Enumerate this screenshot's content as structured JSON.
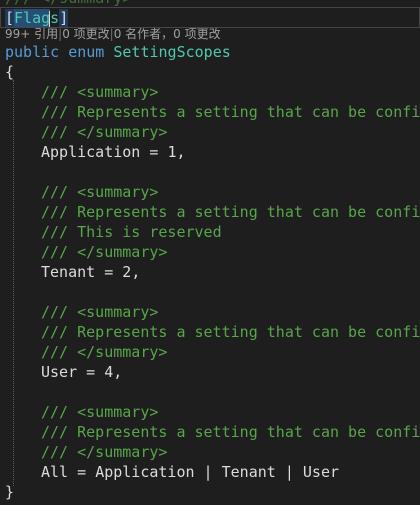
{
  "editor": {
    "previous_line_fragment": "/// </summary>",
    "attribute": {
      "open_bracket": "[",
      "name_selected": "Flag",
      "name_rest": "s",
      "close_bracket": "]"
    },
    "codelens": {
      "references": "99+ 引用",
      "sep1": "|",
      "changes": "0 项更改",
      "sep2": "|",
      "authors": "0 名作者，0 项更改"
    },
    "declaration": {
      "keyword_public": "public",
      "keyword_enum": "enum",
      "type_name": "SettingScopes"
    },
    "open_brace": "{",
    "close_brace": "}",
    "members": [
      {
        "doc_lines": [
          "/// <summary>",
          "/// Represents a setting that can be confi",
          "/// </summary>"
        ],
        "name": "Application",
        "assign": " = ",
        "value": "1",
        "suffix": ","
      },
      {
        "doc_lines": [
          "/// <summary>",
          "/// Represents a setting that can be confi",
          "/// This is reserved",
          "/// </summary>"
        ],
        "name": "Tenant",
        "assign": " = ",
        "value": "2",
        "suffix": ","
      },
      {
        "doc_lines": [
          "/// <summary>",
          "/// Represents a setting that can be confi",
          "/// </summary>"
        ],
        "name": "User",
        "assign": " = ",
        "value": "4",
        "suffix": ","
      },
      {
        "doc_lines": [
          "/// <summary>",
          "/// Represents a setting that can be confi",
          "/// </summary>"
        ],
        "name": "All",
        "assign": " = ",
        "value": "Application | Tenant | User",
        "suffix": ""
      }
    ]
  }
}
